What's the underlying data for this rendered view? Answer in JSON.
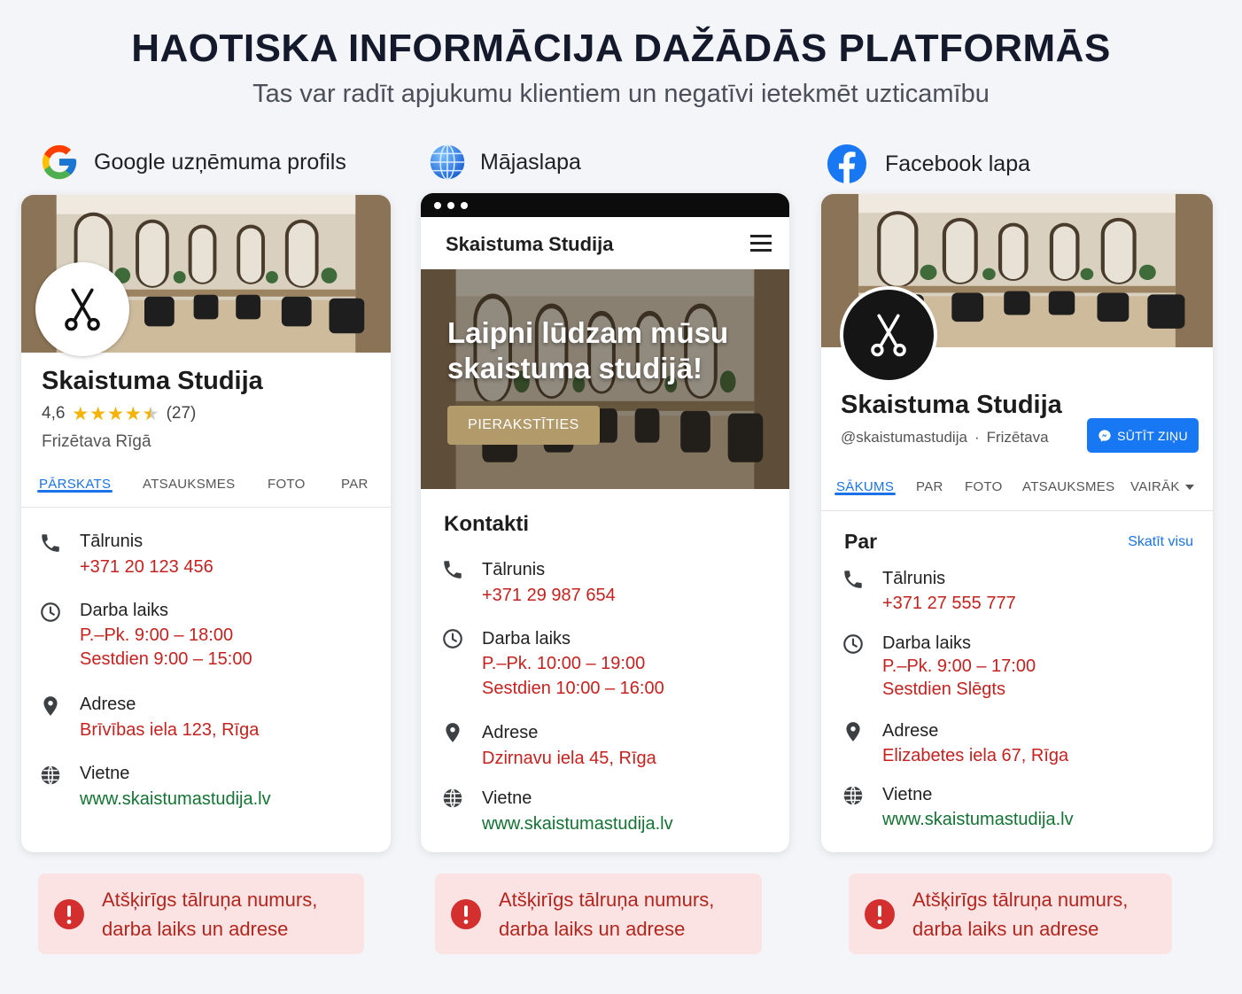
{
  "header": {
    "title": "HAOTISKA INFORMĀCIJA DAŽĀDĀS PLATFORMĀS",
    "subtitle": "Tas var radīt apjukumu klientiem un negatīvi ietekmēt uzticamību"
  },
  "google": {
    "platform": "Google uzņēmuma profils",
    "name": "Skaistuma Studija",
    "rating": "4,6",
    "stars": 4.5,
    "reviews": "(27)",
    "category": "Frizētava Rīgā",
    "tabs": [
      "PĀRSKATS",
      "ATSAUKSMES",
      "FOTO",
      "PAR"
    ],
    "phone_label": "Tālrunis",
    "phone": "+371 20 123 456",
    "hours_label": "Darba laiks",
    "hours_1": "P.–Pk. 9:00 – 18:00",
    "hours_2": "Sestdien 9:00 – 15:00",
    "address_label": "Adrese",
    "address": "Brīvības iela 123, Rīga",
    "site_label": "Vietne",
    "site": "www.skaistumastudija.lv",
    "alert_1": "Atšķirīgs tālruņa numurs,",
    "alert_2": "darba laiks un adrese"
  },
  "website": {
    "platform": "Mājaslapa",
    "brand": "Skaistuma Studija",
    "hero_1": "Laipni lūdzam mūsu",
    "hero_2": "skaistuma studijā!",
    "cta": "PIERAKSTĪTIES",
    "section": "Kontakti",
    "phone_label": "Tālrunis",
    "phone": "+371 29 987 654",
    "hours_label": "Darba laiks",
    "hours_1": "P.–Pk. 10:00 – 19:00",
    "hours_2": "Sestdien 10:00 – 16:00",
    "address_label": "Adrese",
    "address": "Dzirnavu iela 45, Rīga",
    "site_label": "Vietne",
    "site": "www.skaistumastudija.lv",
    "alert_1": "Atšķirīgs tālruņa numurs,",
    "alert_2": "darba laiks un adrese"
  },
  "facebook": {
    "platform": "Facebook lapa",
    "name": "Skaistuma Studija",
    "handle": "@skaistumastudija",
    "category": "Frizētava",
    "message": "SŪTĪT ZIŅU",
    "tabs": [
      "SĀKUMS",
      "PAR",
      "FOTO",
      "ATSAUKSMES",
      "VAIRĀK"
    ],
    "section": "Par",
    "see_all": "Skatīt visu",
    "phone_label": "Tālrunis",
    "phone": "+371 27 555 777",
    "hours_label": "Darba laiks",
    "hours_1": "P.–Pk. 9:00 – 17:00",
    "hours_2": "Sestdien Slēgts",
    "address_label": "Adrese",
    "address": "Elizabetes iela 67, Rīga",
    "site_label": "Vietne",
    "site": "www.skaistumastudija.lv",
    "alert_1": "Atšķirīgs tālruņa numurs,",
    "alert_2": "darba laiks un adrese"
  },
  "colors": {
    "accent_blue": "#1a73e8",
    "facebook_blue": "#1877f2",
    "error_red": "#c5221f",
    "link_green": "#137333",
    "alert_bg": "#fbe3e3",
    "star_gold": "#f4b400",
    "cta_gold": "#b39a6a"
  }
}
